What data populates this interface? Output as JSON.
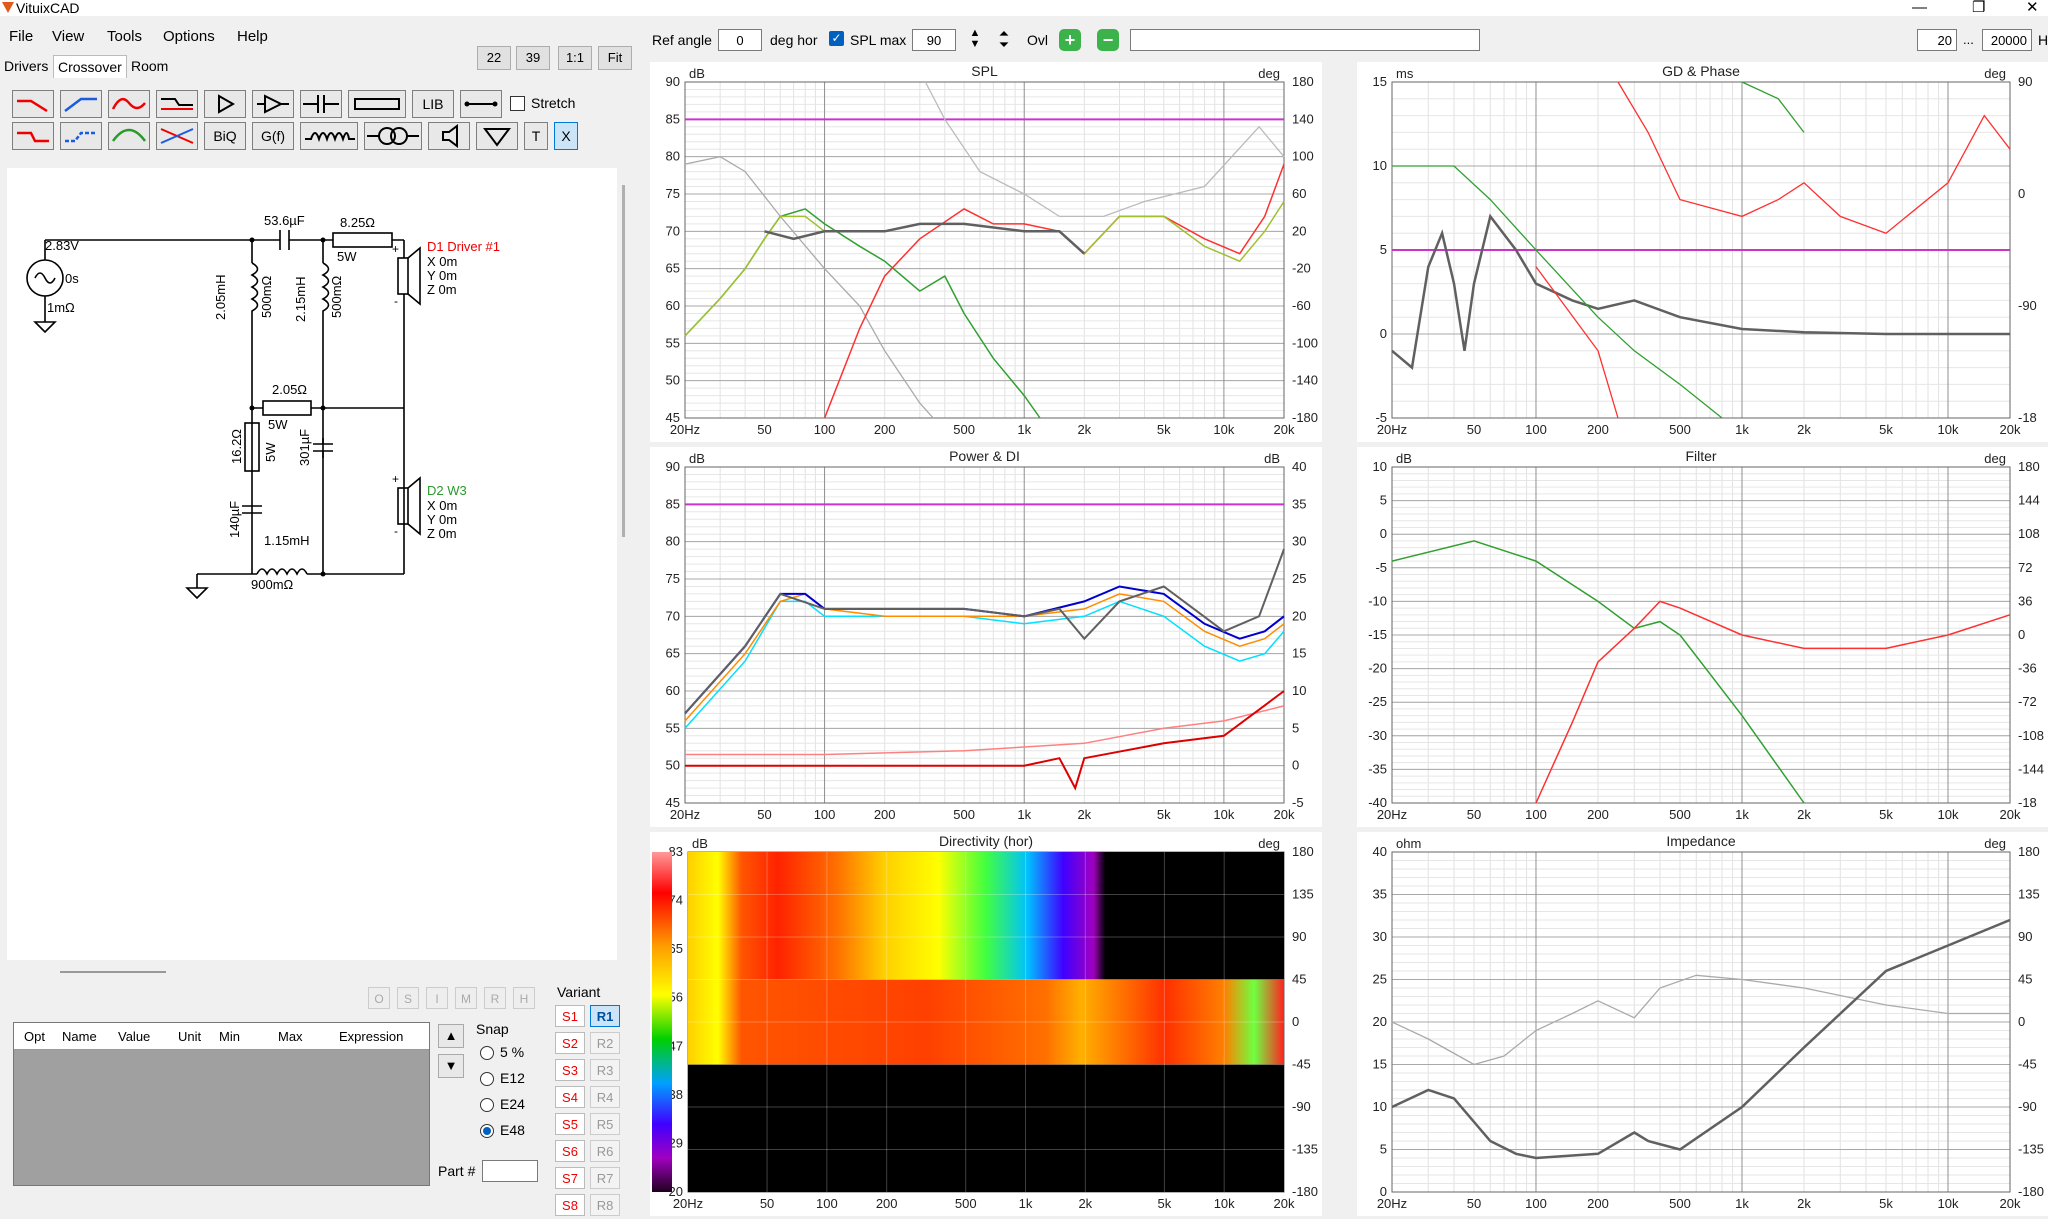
{
  "app": {
    "title": "VituixCAD"
  },
  "menu": [
    "File",
    "View",
    "Tools",
    "Options",
    "Help"
  ],
  "tabs": [
    "Drivers",
    "Crossover",
    "Room"
  ],
  "zoom_buttons": [
    "22",
    "39",
    "1:1",
    "Fit"
  ],
  "top_toolbar": {
    "ref_angle_label": "Ref angle",
    "ref_angle_value": "0",
    "deg_hor_label": "deg hor",
    "spl_max_label": "SPL max",
    "spl_max_value": "90",
    "ovl_label": "Ovl",
    "freq_min": "20",
    "ellipsis": "...",
    "freq_max": "20000",
    "unit_h": "H"
  },
  "component_toolbar": {
    "lib_label": "LIB",
    "biq_label": "BiQ",
    "gf_label": "G(f)",
    "t_label": "T",
    "x_label": "X",
    "stretch_label": "Stretch"
  },
  "schematic": {
    "source_voltage": "2.83V",
    "source_delay": "0s",
    "source_r": "1mΩ",
    "c1": "53.6µF",
    "r1": "8.25Ω",
    "r1_power": "5W",
    "l1": "2.05mH",
    "l1_r": "500mΩ",
    "l2": "2.15mH",
    "l2_r": "500mΩ",
    "d1_name": "D1 Driver #1",
    "d1_x": "X 0m",
    "d1_y": "Y 0m",
    "d1_z": "Z 0m",
    "r2": "2.05Ω",
    "r2_power": "5W",
    "r3": "16.2Ω",
    "r3_power": "5W",
    "c2": "301µF",
    "c3": "140µF",
    "l3": "1.15mH",
    "l3_r": "900mΩ",
    "d2_name": "D2 W3",
    "d2_x": "X 0m",
    "d2_y": "Y 0m",
    "d2_z": "Z 0m",
    "plus": "+",
    "minus": "-"
  },
  "grid_buttons": [
    "O",
    "S",
    "I",
    "M",
    "R",
    "H"
  ],
  "opt_table_headers": [
    "Opt",
    "Name",
    "Value",
    "Unit",
    "Min",
    "Max",
    "Expression"
  ],
  "snap": {
    "label": "Snap",
    "options": [
      "5 %",
      "E12",
      "E24",
      "E48"
    ],
    "selected": "E48"
  },
  "variant": {
    "label": "Variant",
    "s": [
      "S1",
      "S2",
      "S3",
      "S4",
      "S5",
      "S6",
      "S7",
      "S8"
    ],
    "r": [
      "R1",
      "R2",
      "R3",
      "R4",
      "R5",
      "R6",
      "R7",
      "R8"
    ],
    "active_r": "R1"
  },
  "part_label": "Part #",
  "freq_ticks": [
    "20Hz",
    "50",
    "100",
    "200",
    "500",
    "1k",
    "2k",
    "5k",
    "10k",
    "20k"
  ],
  "charts": {
    "spl": {
      "title": "SPL",
      "left_unit": "dB",
      "right_unit": "deg",
      "left_ticks": [
        "90",
        "85",
        "80",
        "75",
        "70",
        "65",
        "60",
        "55",
        "50",
        "45"
      ],
      "right_ticks": [
        "180",
        "140",
        "100",
        "60",
        "20",
        "-20",
        "-60",
        "-100",
        "-140",
        "-180"
      ]
    },
    "gd": {
      "title": "GD & Phase",
      "left_unit": "ms",
      "right_unit": "deg",
      "left_ticks": [
        "15",
        "10",
        "5",
        "0",
        "-5"
      ],
      "right_ticks": [
        "90",
        "0",
        "-90",
        "-18"
      ]
    },
    "power": {
      "title": "Power & DI",
      "left_unit": "dB",
      "right_unit": "dB",
      "left_ticks": [
        "90",
        "85",
        "80",
        "75",
        "70",
        "65",
        "60",
        "55",
        "50",
        "45"
      ],
      "right_ticks": [
        "40",
        "35",
        "30",
        "25",
        "20",
        "15",
        "10",
        "5",
        "0",
        "-5"
      ]
    },
    "filter": {
      "title": "Filter",
      "left_unit": "dB",
      "right_unit": "deg",
      "left_ticks": [
        "10",
        "5",
        "0",
        "-5",
        "-10",
        "-15",
        "-20",
        "-25",
        "-30",
        "-35",
        "-40"
      ],
      "right_ticks": [
        "180",
        "144",
        "108",
        "72",
        "36",
        "0",
        "-36",
        "-72",
        "-108",
        "-144",
        "-18"
      ]
    },
    "directivity": {
      "title": "Directivity (hor)",
      "left_unit": "dB",
      "right_unit": "deg",
      "scale_ticks": [
        "83",
        "74",
        "65",
        "56",
        "47",
        "38",
        "29",
        "20"
      ],
      "right_ticks": [
        "180",
        "135",
        "90",
        "45",
        "0",
        "-45",
        "-90",
        "-135",
        "-180"
      ]
    },
    "impedance": {
      "title": "Impedance",
      "left_unit": "ohm",
      "right_unit": "deg",
      "left_ticks": [
        "40",
        "35",
        "30",
        "25",
        "20",
        "15",
        "10",
        "5",
        "0"
      ],
      "right_ticks": [
        "180",
        "135",
        "90",
        "45",
        "0",
        "-45",
        "-90",
        "-135",
        "-180"
      ]
    }
  },
  "colors": {
    "magenta_limit": "#cc33cc",
    "driver1": "#ff3030",
    "driver2": "#30a030",
    "sum": "#606060"
  }
}
